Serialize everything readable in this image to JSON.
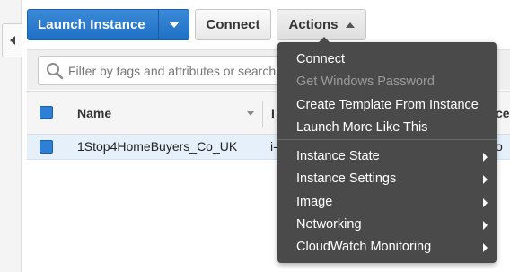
{
  "toolbar": {
    "launch_label": "Launch Instance",
    "connect_label": "Connect",
    "actions_label": "Actions"
  },
  "filter": {
    "placeholder": "Filter by tags and attributes or search by keyword"
  },
  "table": {
    "columns": [
      {
        "label": "Name"
      },
      {
        "label": "I"
      },
      {
        "label": "ce"
      }
    ],
    "rows": [
      {
        "name": "1Stop4HomeBuyers_Co_UK",
        "id_partial": "i-",
        "extra_partial": "o"
      }
    ]
  },
  "actions_menu": {
    "items": [
      {
        "label": "Connect",
        "disabled": false
      },
      {
        "label": "Get Windows Password",
        "disabled": true
      },
      {
        "label": "Create Template From Instance",
        "disabled": false
      },
      {
        "label": "Launch More Like This",
        "disabled": false
      },
      {
        "label": "Instance State",
        "submenu": true
      },
      {
        "label": "Instance Settings",
        "submenu": true
      },
      {
        "label": "Image",
        "submenu": true
      },
      {
        "label": "Networking",
        "submenu": true
      },
      {
        "label": "CloudWatch Monitoring",
        "submenu": true
      }
    ]
  },
  "colors": {
    "primary": "#1f6fc5",
    "menu_bg": "#4a4a4a",
    "row_selected": "#e6f0fa"
  }
}
